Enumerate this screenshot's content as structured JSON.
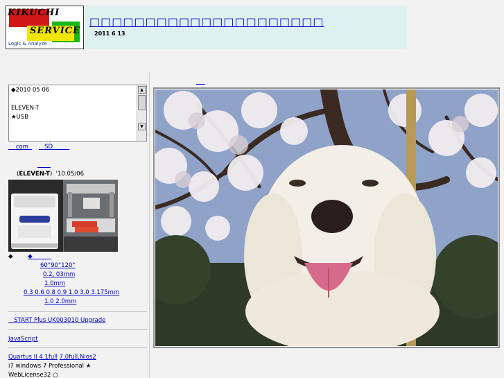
{
  "header": {
    "logo": {
      "word1": "KIKUCHI",
      "word2": "SERVICE",
      "tagline": "Logic & Analyze"
    },
    "site_title": "□□□□□□□□□□□□□□□□□□□□□",
    "date": "2011  6  13"
  },
  "sidebar": {
    "news_box": {
      "lines": [
        "◆2010 05 06",
        "",
        "ELEVEN-T",
        "★USB"
      ]
    },
    "links_row": {
      "com": "com",
      "sd": "SD"
    },
    "product": {
      "heading_link": "",
      "caption_model": "ELEVEN-T",
      "caption_date": "'10.05/06"
    },
    "spec": {
      "bullets_link": "◆  ◆",
      "angles": "60°90°120°",
      "pitch": "0.2, 03mm",
      "thickness": "1.0mm",
      "sizes": "0.3 0.6 0.8 0.9 1.0 3.0 3.175mm",
      "range": "1.0 2.0mm"
    },
    "upgrade_link": "START Plus UK003010 Upgrade",
    "js_link": "JavaScript",
    "quartus": {
      "link1": "Quartus II 4.1full",
      "link2": "7.0full,Nios2"
    },
    "env_line": "i7 windows 7 Professional  ★",
    "license_line": "WebLicense32      ○"
  },
  "main": {
    "top_link": "",
    "photo_alt": "dog"
  },
  "colors": {
    "title_band": "#dff0f0",
    "link": "#0000cc",
    "logo_red": "#d01818",
    "logo_yellow": "#f2e600",
    "logo_green": "#18b818"
  }
}
